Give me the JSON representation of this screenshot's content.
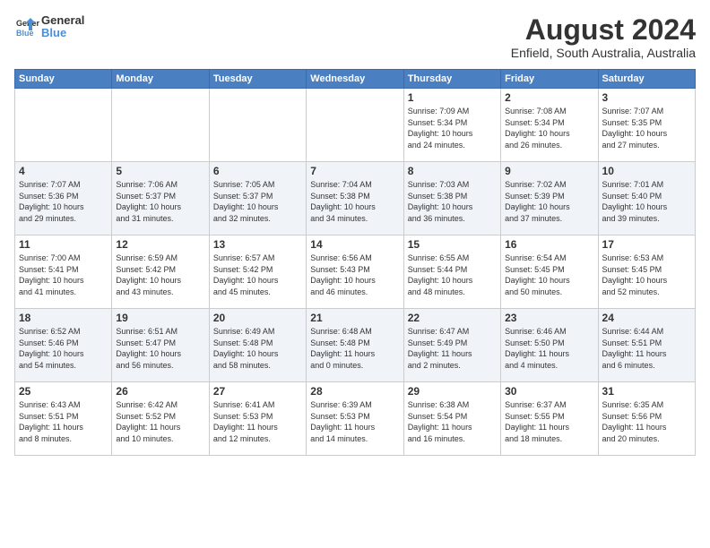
{
  "logo": {
    "line1": "General",
    "line2": "Blue"
  },
  "title": "August 2024",
  "subtitle": "Enfield, South Australia, Australia",
  "days_of_week": [
    "Sunday",
    "Monday",
    "Tuesday",
    "Wednesday",
    "Thursday",
    "Friday",
    "Saturday"
  ],
  "weeks": [
    [
      {
        "day": "",
        "content": ""
      },
      {
        "day": "",
        "content": ""
      },
      {
        "day": "",
        "content": ""
      },
      {
        "day": "",
        "content": ""
      },
      {
        "day": "1",
        "content": "Sunrise: 7:09 AM\nSunset: 5:34 PM\nDaylight: 10 hours\nand 24 minutes."
      },
      {
        "day": "2",
        "content": "Sunrise: 7:08 AM\nSunset: 5:34 PM\nDaylight: 10 hours\nand 26 minutes."
      },
      {
        "day": "3",
        "content": "Sunrise: 7:07 AM\nSunset: 5:35 PM\nDaylight: 10 hours\nand 27 minutes."
      }
    ],
    [
      {
        "day": "4",
        "content": "Sunrise: 7:07 AM\nSunset: 5:36 PM\nDaylight: 10 hours\nand 29 minutes."
      },
      {
        "day": "5",
        "content": "Sunrise: 7:06 AM\nSunset: 5:37 PM\nDaylight: 10 hours\nand 31 minutes."
      },
      {
        "day": "6",
        "content": "Sunrise: 7:05 AM\nSunset: 5:37 PM\nDaylight: 10 hours\nand 32 minutes."
      },
      {
        "day": "7",
        "content": "Sunrise: 7:04 AM\nSunset: 5:38 PM\nDaylight: 10 hours\nand 34 minutes."
      },
      {
        "day": "8",
        "content": "Sunrise: 7:03 AM\nSunset: 5:38 PM\nDaylight: 10 hours\nand 36 minutes."
      },
      {
        "day": "9",
        "content": "Sunrise: 7:02 AM\nSunset: 5:39 PM\nDaylight: 10 hours\nand 37 minutes."
      },
      {
        "day": "10",
        "content": "Sunrise: 7:01 AM\nSunset: 5:40 PM\nDaylight: 10 hours\nand 39 minutes."
      }
    ],
    [
      {
        "day": "11",
        "content": "Sunrise: 7:00 AM\nSunset: 5:41 PM\nDaylight: 10 hours\nand 41 minutes."
      },
      {
        "day": "12",
        "content": "Sunrise: 6:59 AM\nSunset: 5:42 PM\nDaylight: 10 hours\nand 43 minutes."
      },
      {
        "day": "13",
        "content": "Sunrise: 6:57 AM\nSunset: 5:42 PM\nDaylight: 10 hours\nand 45 minutes."
      },
      {
        "day": "14",
        "content": "Sunrise: 6:56 AM\nSunset: 5:43 PM\nDaylight: 10 hours\nand 46 minutes."
      },
      {
        "day": "15",
        "content": "Sunrise: 6:55 AM\nSunset: 5:44 PM\nDaylight: 10 hours\nand 48 minutes."
      },
      {
        "day": "16",
        "content": "Sunrise: 6:54 AM\nSunset: 5:45 PM\nDaylight: 10 hours\nand 50 minutes."
      },
      {
        "day": "17",
        "content": "Sunrise: 6:53 AM\nSunset: 5:45 PM\nDaylight: 10 hours\nand 52 minutes."
      }
    ],
    [
      {
        "day": "18",
        "content": "Sunrise: 6:52 AM\nSunset: 5:46 PM\nDaylight: 10 hours\nand 54 minutes."
      },
      {
        "day": "19",
        "content": "Sunrise: 6:51 AM\nSunset: 5:47 PM\nDaylight: 10 hours\nand 56 minutes."
      },
      {
        "day": "20",
        "content": "Sunrise: 6:49 AM\nSunset: 5:48 PM\nDaylight: 10 hours\nand 58 minutes."
      },
      {
        "day": "21",
        "content": "Sunrise: 6:48 AM\nSunset: 5:48 PM\nDaylight: 11 hours\nand 0 minutes."
      },
      {
        "day": "22",
        "content": "Sunrise: 6:47 AM\nSunset: 5:49 PM\nDaylight: 11 hours\nand 2 minutes."
      },
      {
        "day": "23",
        "content": "Sunrise: 6:46 AM\nSunset: 5:50 PM\nDaylight: 11 hours\nand 4 minutes."
      },
      {
        "day": "24",
        "content": "Sunrise: 6:44 AM\nSunset: 5:51 PM\nDaylight: 11 hours\nand 6 minutes."
      }
    ],
    [
      {
        "day": "25",
        "content": "Sunrise: 6:43 AM\nSunset: 5:51 PM\nDaylight: 11 hours\nand 8 minutes."
      },
      {
        "day": "26",
        "content": "Sunrise: 6:42 AM\nSunset: 5:52 PM\nDaylight: 11 hours\nand 10 minutes."
      },
      {
        "day": "27",
        "content": "Sunrise: 6:41 AM\nSunset: 5:53 PM\nDaylight: 11 hours\nand 12 minutes."
      },
      {
        "day": "28",
        "content": "Sunrise: 6:39 AM\nSunset: 5:53 PM\nDaylight: 11 hours\nand 14 minutes."
      },
      {
        "day": "29",
        "content": "Sunrise: 6:38 AM\nSunset: 5:54 PM\nDaylight: 11 hours\nand 16 minutes."
      },
      {
        "day": "30",
        "content": "Sunrise: 6:37 AM\nSunset: 5:55 PM\nDaylight: 11 hours\nand 18 minutes."
      },
      {
        "day": "31",
        "content": "Sunrise: 6:35 AM\nSunset: 5:56 PM\nDaylight: 11 hours\nand 20 minutes."
      }
    ]
  ]
}
